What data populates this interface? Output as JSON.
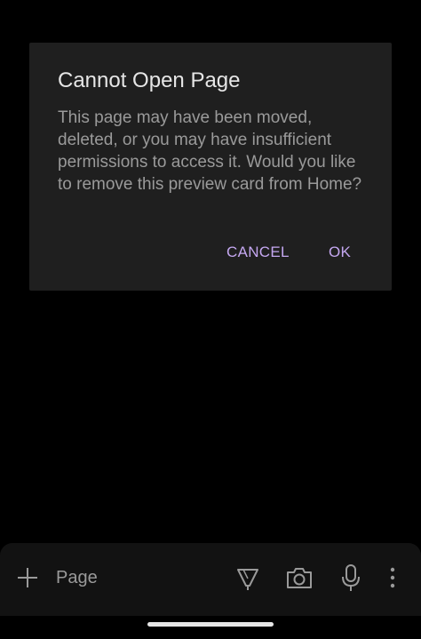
{
  "dialog": {
    "title": "Cannot Open Page",
    "message": "This page may have been moved, deleted, or you may have insufficient permissions to access it. Would you like to remove this preview card from Home?",
    "cancel_label": "CANCEL",
    "ok_label": "OK",
    "accent_color": "#c4a7f0"
  },
  "bottom_bar": {
    "input_placeholder": "Page",
    "icons": [
      "add-icon",
      "pen-icon",
      "camera-icon",
      "microphone-icon",
      "more-vertical-icon"
    ]
  }
}
